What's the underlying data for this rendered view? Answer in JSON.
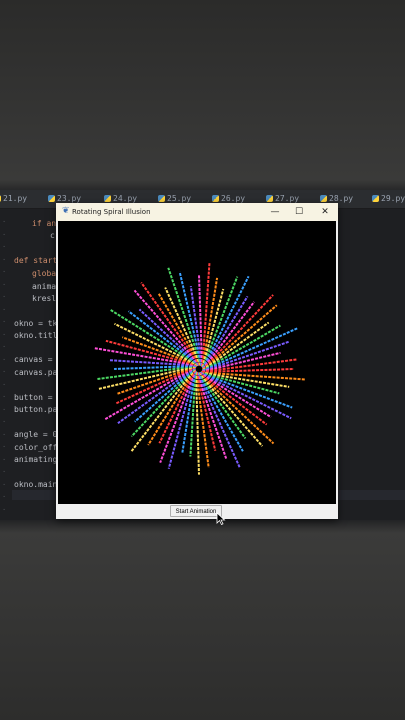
{
  "ide": {
    "tabs": [
      {
        "label": "21.py"
      },
      {
        "label": "23.py"
      },
      {
        "label": "24.py"
      },
      {
        "label": "25.py"
      },
      {
        "label": "26.py"
      },
      {
        "label": "27.py"
      },
      {
        "label": "28.py"
      },
      {
        "label": "29.py"
      }
    ],
    "code_lines": [
      "if an",
      "c",
      "def start",
      "globa",
      "anima",
      "kresl",
      "okno = tk",
      "okno.titl",
      "canvas =",
      "canvas.pa",
      "button =",
      "button.pa",
      "angle = 0",
      "color_off",
      "animating",
      "okno.main"
    ]
  },
  "window": {
    "title": "Rotating Spiral Illusion",
    "minimize_glyph": "—",
    "maximize_glyph": "☐",
    "close_glyph": "✕",
    "start_button_label": "Start Animation",
    "canvas_background": "#000000",
    "ray_colors": [
      "#ff3b3b",
      "#ff8c1a",
      "#ffe066",
      "#4cd964",
      "#3aa0ff",
      "#7a5cff",
      "#ff4fd8"
    ]
  },
  "colors": {
    "ide_background": "#1e1f22",
    "titlebar": "#f7f3e3",
    "keyword": "#cf8e6d",
    "function": "#56a8f5"
  }
}
